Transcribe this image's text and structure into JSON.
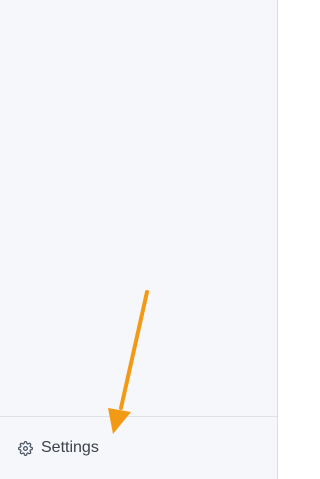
{
  "sidebar": {
    "footer": {
      "settings_label": "Settings",
      "settings_icon": "gear-icon"
    }
  },
  "annotation": {
    "type": "arrow",
    "color": "#f39a14"
  }
}
